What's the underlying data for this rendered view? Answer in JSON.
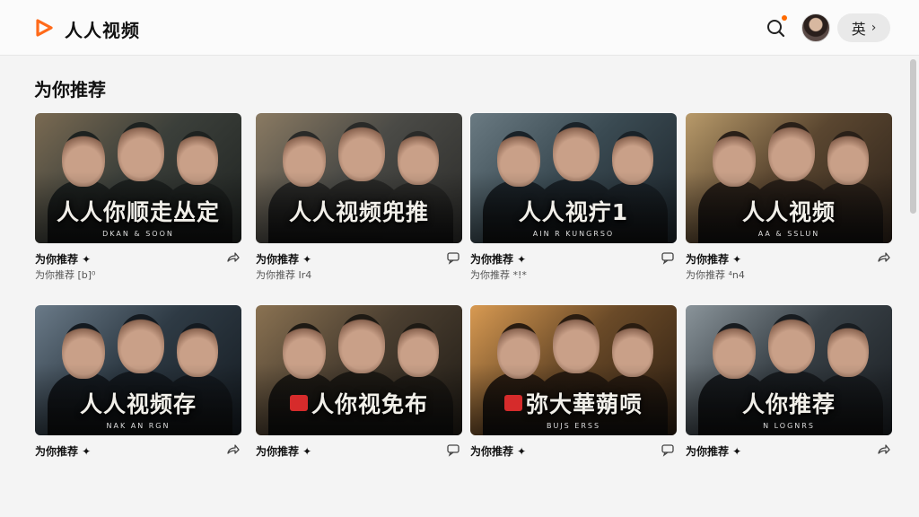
{
  "app": {
    "title": "人人视频",
    "accent": "#ff6a1a"
  },
  "header": {
    "search_icon": "search-icon",
    "notification_color": "#ff6a00",
    "lang_label": "英",
    "lang_chevron": "›"
  },
  "section": {
    "title": "为你推荐"
  },
  "cards": [
    {
      "overlay": "人人你顺走丛定",
      "overlay_sub": "DKAN & SOON",
      "title": "为你推荐 ✦",
      "subtitle": "为你推荐 [b]⁰",
      "action_icon": "share-icon",
      "palette": [
        "#3b3f3a",
        "#1e2220",
        "#7a6a52"
      ]
    },
    {
      "overlay": "人人视频兜推",
      "overlay_sub": "",
      "title": "为你推荐 ✦",
      "subtitle": "为你推荐 Ir4",
      "action_icon": "comment-icon",
      "palette": [
        "#4a4a46",
        "#2a2a28",
        "#8a7a62"
      ]
    },
    {
      "overlay": "人人视疔1",
      "overlay_sub": "AIN R KUNGRSO",
      "title": "为你推荐 ✦",
      "subtitle": "为你推荐 *!*",
      "action_icon": "comment-icon",
      "palette": [
        "#3a4a52",
        "#1a2228",
        "#6a7a82"
      ]
    },
    {
      "overlay": "人人视频",
      "overlay_sub": "AA & SSLUN",
      "title": "为你推荐 ✦",
      "subtitle": "为你推荐 ⁴n4",
      "action_icon": "share-icon",
      "palette": [
        "#5a4630",
        "#2a2018",
        "#b89a6a"
      ]
    },
    {
      "overlay": "人人视频存",
      "overlay_sub": "NAK AN RGN",
      "title": "为你推荐 ✦",
      "subtitle": "",
      "action_icon": "share-icon",
      "palette": [
        "#2e3a44",
        "#141a20",
        "#6a7a88"
      ]
    },
    {
      "overlay": "人你视免布",
      "overlay_sub": "",
      "title": "为你推荐 ✦",
      "subtitle": "",
      "action_icon": "comment-icon",
      "palette": [
        "#4a3e30",
        "#1e1a14",
        "#8a7252"
      ]
    },
    {
      "overlay": "弥大華蒴唝",
      "overlay_sub": "BUJS ERSS",
      "title": "为你推荐 ✦",
      "subtitle": "",
      "action_icon": "comment-icon",
      "palette": [
        "#6a4a28",
        "#2a1c10",
        "#d89a52"
      ]
    },
    {
      "overlay": "人你推荐",
      "overlay_sub": "N LOGNRS",
      "title": "为你推荐 ✦",
      "subtitle": "",
      "action_icon": "share-icon",
      "palette": [
        "#3a4248",
        "#181c20",
        "#8a949a"
      ]
    }
  ]
}
